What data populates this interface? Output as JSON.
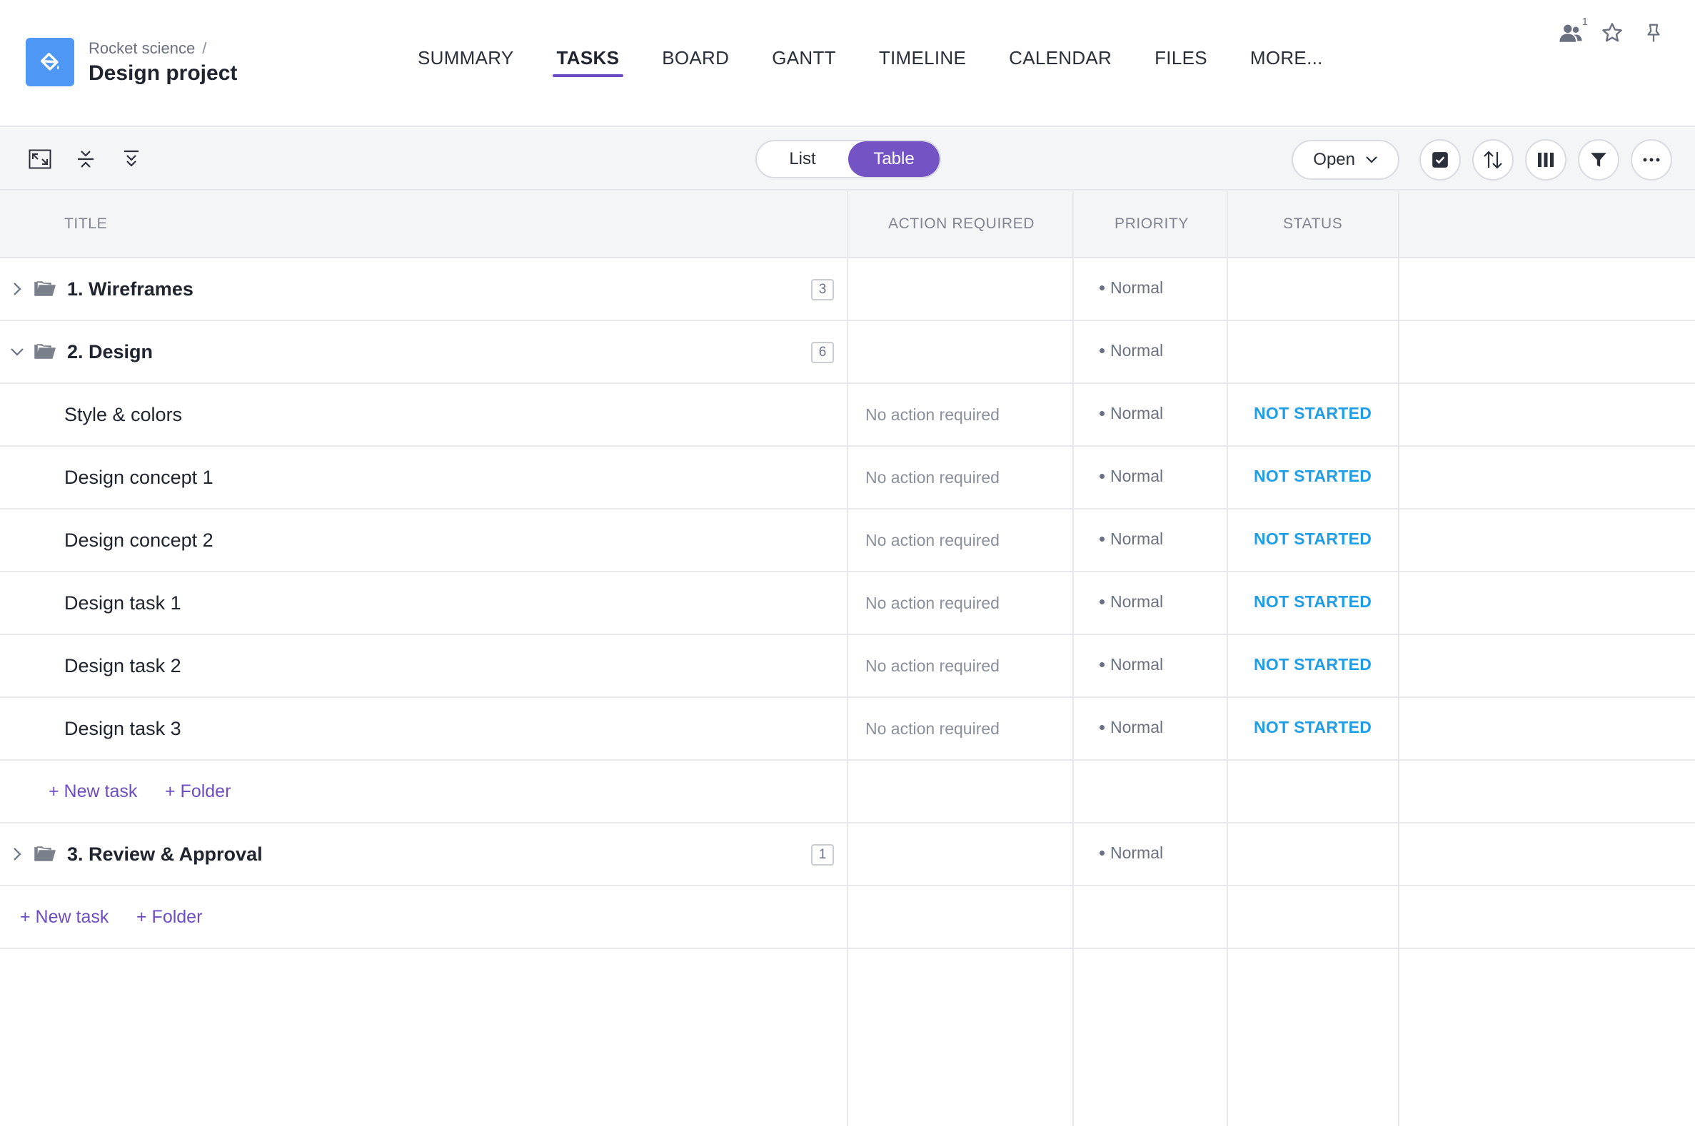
{
  "header": {
    "breadcrumb": "Rocket science",
    "breadcrumb_sep": "/",
    "title": "Design project",
    "nav_tabs": [
      "SUMMARY",
      "TASKS",
      "BOARD",
      "GANTT",
      "TIMELINE",
      "CALENDAR",
      "FILES",
      "MORE..."
    ],
    "active_tab": "TASKS",
    "members_count": "1"
  },
  "toolbar": {
    "view_list": "List",
    "view_table": "Table",
    "active_view": "Table",
    "filter_select": "Open"
  },
  "table": {
    "columns": [
      "TITLE",
      "ACTION REQUIRED",
      "PRIORITY",
      "STATUS"
    ],
    "rows": [
      {
        "type": "folder",
        "title": "1. Wireframes",
        "count": "3",
        "expanded": false,
        "action": "",
        "priority": "Normal",
        "status": ""
      },
      {
        "type": "folder",
        "title": "2. Design",
        "count": "6",
        "expanded": true,
        "action": "",
        "priority": "Normal",
        "status": ""
      },
      {
        "type": "task",
        "title": "Style & colors",
        "action": "No action required",
        "priority": "Normal",
        "status": "NOT STARTED"
      },
      {
        "type": "task",
        "title": "Design concept 1",
        "action": "No action required",
        "priority": "Normal",
        "status": "NOT STARTED"
      },
      {
        "type": "task",
        "title": "Design concept 2",
        "action": "No action required",
        "priority": "Normal",
        "status": "NOT STARTED"
      },
      {
        "type": "task",
        "title": "Design task 1",
        "action": "No action required",
        "priority": "Normal",
        "status": "NOT STARTED"
      },
      {
        "type": "task",
        "title": "Design task 2",
        "action": "No action required",
        "priority": "Normal",
        "status": "NOT STARTED"
      },
      {
        "type": "task",
        "title": "Design task 3",
        "action": "No action required",
        "priority": "Normal",
        "status": "NOT STARTED"
      },
      {
        "type": "add",
        "new_task": "+ New task",
        "new_folder": "+ Folder"
      },
      {
        "type": "folder",
        "title": "3. Review & Approval",
        "count": "1",
        "expanded": false,
        "action": "",
        "priority": "Normal",
        "status": ""
      },
      {
        "type": "add-root",
        "new_task": "+ New task",
        "new_folder": "+ Folder"
      }
    ]
  },
  "colors": {
    "accent": "#6d4cc4",
    "toggle_active": "#7453c4",
    "project_icon": "#4e97f5",
    "status_not_started": "#1e9ee6"
  },
  "icons": {
    "project": "paint-bucket-icon",
    "members": "users-icon",
    "favorite": "star-icon",
    "pin": "pin-icon",
    "fullscreen": "expand-icon",
    "collapse_all": "collapse-icon",
    "expand_all": "expand-all-icon",
    "select_dropdown": "chevron-down-icon",
    "checkbox": "checkbox-icon",
    "sort": "sort-icon",
    "columns": "columns-icon",
    "filter": "filter-icon",
    "more": "more-icon"
  }
}
